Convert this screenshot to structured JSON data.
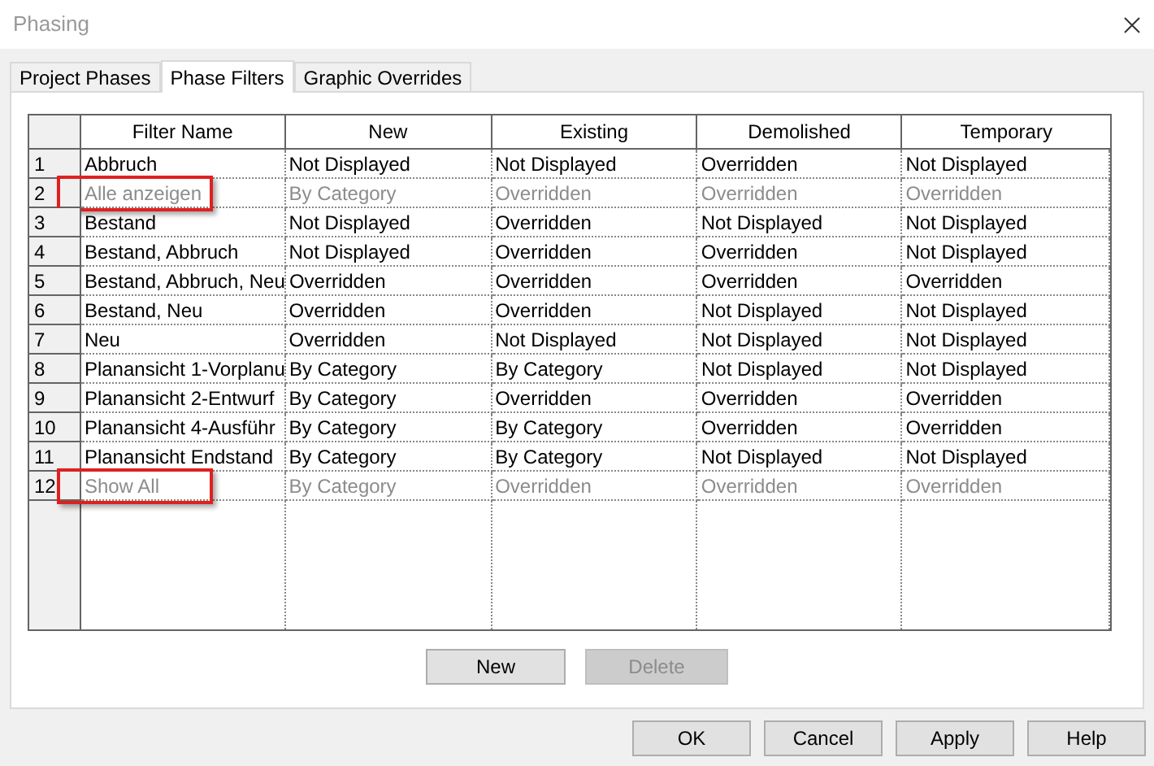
{
  "window": {
    "title": "Phasing"
  },
  "tabs": [
    {
      "label": "Project Phases",
      "selected": false
    },
    {
      "label": "Phase Filters",
      "selected": true
    },
    {
      "label": "Graphic Overrides",
      "selected": false
    }
  ],
  "table": {
    "columns": [
      "Filter Name",
      "New",
      "Existing",
      "Demolished",
      "Temporary"
    ],
    "rows": [
      {
        "number": "1",
        "cells": [
          "Abbruch",
          "Not Displayed",
          "Not Displayed",
          "Overridden",
          "Not Displayed"
        ],
        "disabled": false,
        "highlighted": false
      },
      {
        "number": "2",
        "cells": [
          "Alle anzeigen",
          "By Category",
          "Overridden",
          "Overridden",
          "Overridden"
        ],
        "disabled": true,
        "highlighted": true
      },
      {
        "number": "3",
        "cells": [
          "Bestand",
          "Not Displayed",
          "Overridden",
          "Not Displayed",
          "Not Displayed"
        ],
        "disabled": false,
        "highlighted": false
      },
      {
        "number": "4",
        "cells": [
          "Bestand, Abbruch",
          "Not Displayed",
          "Overridden",
          "Overridden",
          "Not Displayed"
        ],
        "disabled": false,
        "highlighted": false
      },
      {
        "number": "5",
        "cells": [
          "Bestand, Abbruch, Neu",
          "Overridden",
          "Overridden",
          "Overridden",
          "Overridden"
        ],
        "disabled": false,
        "highlighted": false
      },
      {
        "number": "6",
        "cells": [
          "Bestand, Neu",
          "Overridden",
          "Overridden",
          "Not Displayed",
          "Not Displayed"
        ],
        "disabled": false,
        "highlighted": false
      },
      {
        "number": "7",
        "cells": [
          "Neu",
          "Overridden",
          "Not Displayed",
          "Not Displayed",
          "Not Displayed"
        ],
        "disabled": false,
        "highlighted": false
      },
      {
        "number": "8",
        "cells": [
          "Planansicht 1-Vorplanu",
          "By Category",
          "By Category",
          "Not Displayed",
          "Not Displayed"
        ],
        "disabled": false,
        "highlighted": false
      },
      {
        "number": "9",
        "cells": [
          "Planansicht 2-Entwurf",
          "By Category",
          "Overridden",
          "Overridden",
          "Overridden"
        ],
        "disabled": false,
        "highlighted": false
      },
      {
        "number": "10",
        "cells": [
          "Planansicht 4-Ausführ",
          "By Category",
          "By Category",
          "Overridden",
          "Overridden"
        ],
        "disabled": false,
        "highlighted": false
      },
      {
        "number": "11",
        "cells": [
          "Planansicht Endstand",
          "By Category",
          "By Category",
          "Not Displayed",
          "Not Displayed"
        ],
        "disabled": false,
        "highlighted": false
      },
      {
        "number": "12",
        "cells": [
          "Show All",
          "By Category",
          "Overridden",
          "Overridden",
          "Overridden"
        ],
        "disabled": true,
        "highlighted": true
      }
    ]
  },
  "table_buttons": [
    {
      "label": "New",
      "disabled": false
    },
    {
      "label": "Delete",
      "disabled": true
    }
  ],
  "buttons": [
    "OK",
    "Cancel",
    "Apply",
    "Help"
  ]
}
